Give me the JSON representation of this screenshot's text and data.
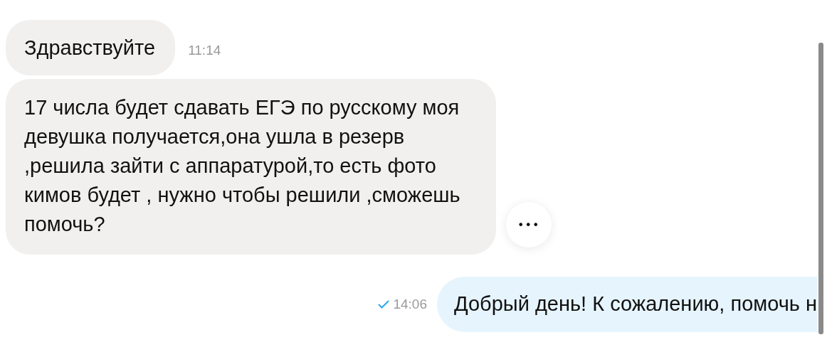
{
  "messages": [
    {
      "kind": "incoming",
      "text": "Здравствуйте",
      "time": "11:14"
    },
    {
      "kind": "incoming",
      "text": "17 числа будет сдавать ЕГЭ по русскому моя\nдевушка получается,она ушла в резерв\n,решила зайти с аппаратурой,то есть фото\nкимов будет , нужно чтобы решили ,сможешь\nпомочь?",
      "more_button": "•••"
    },
    {
      "kind": "outgoing",
      "text": "Добрый день! К сожалению, помочь н",
      "time": "14:06",
      "read": true
    }
  ]
}
